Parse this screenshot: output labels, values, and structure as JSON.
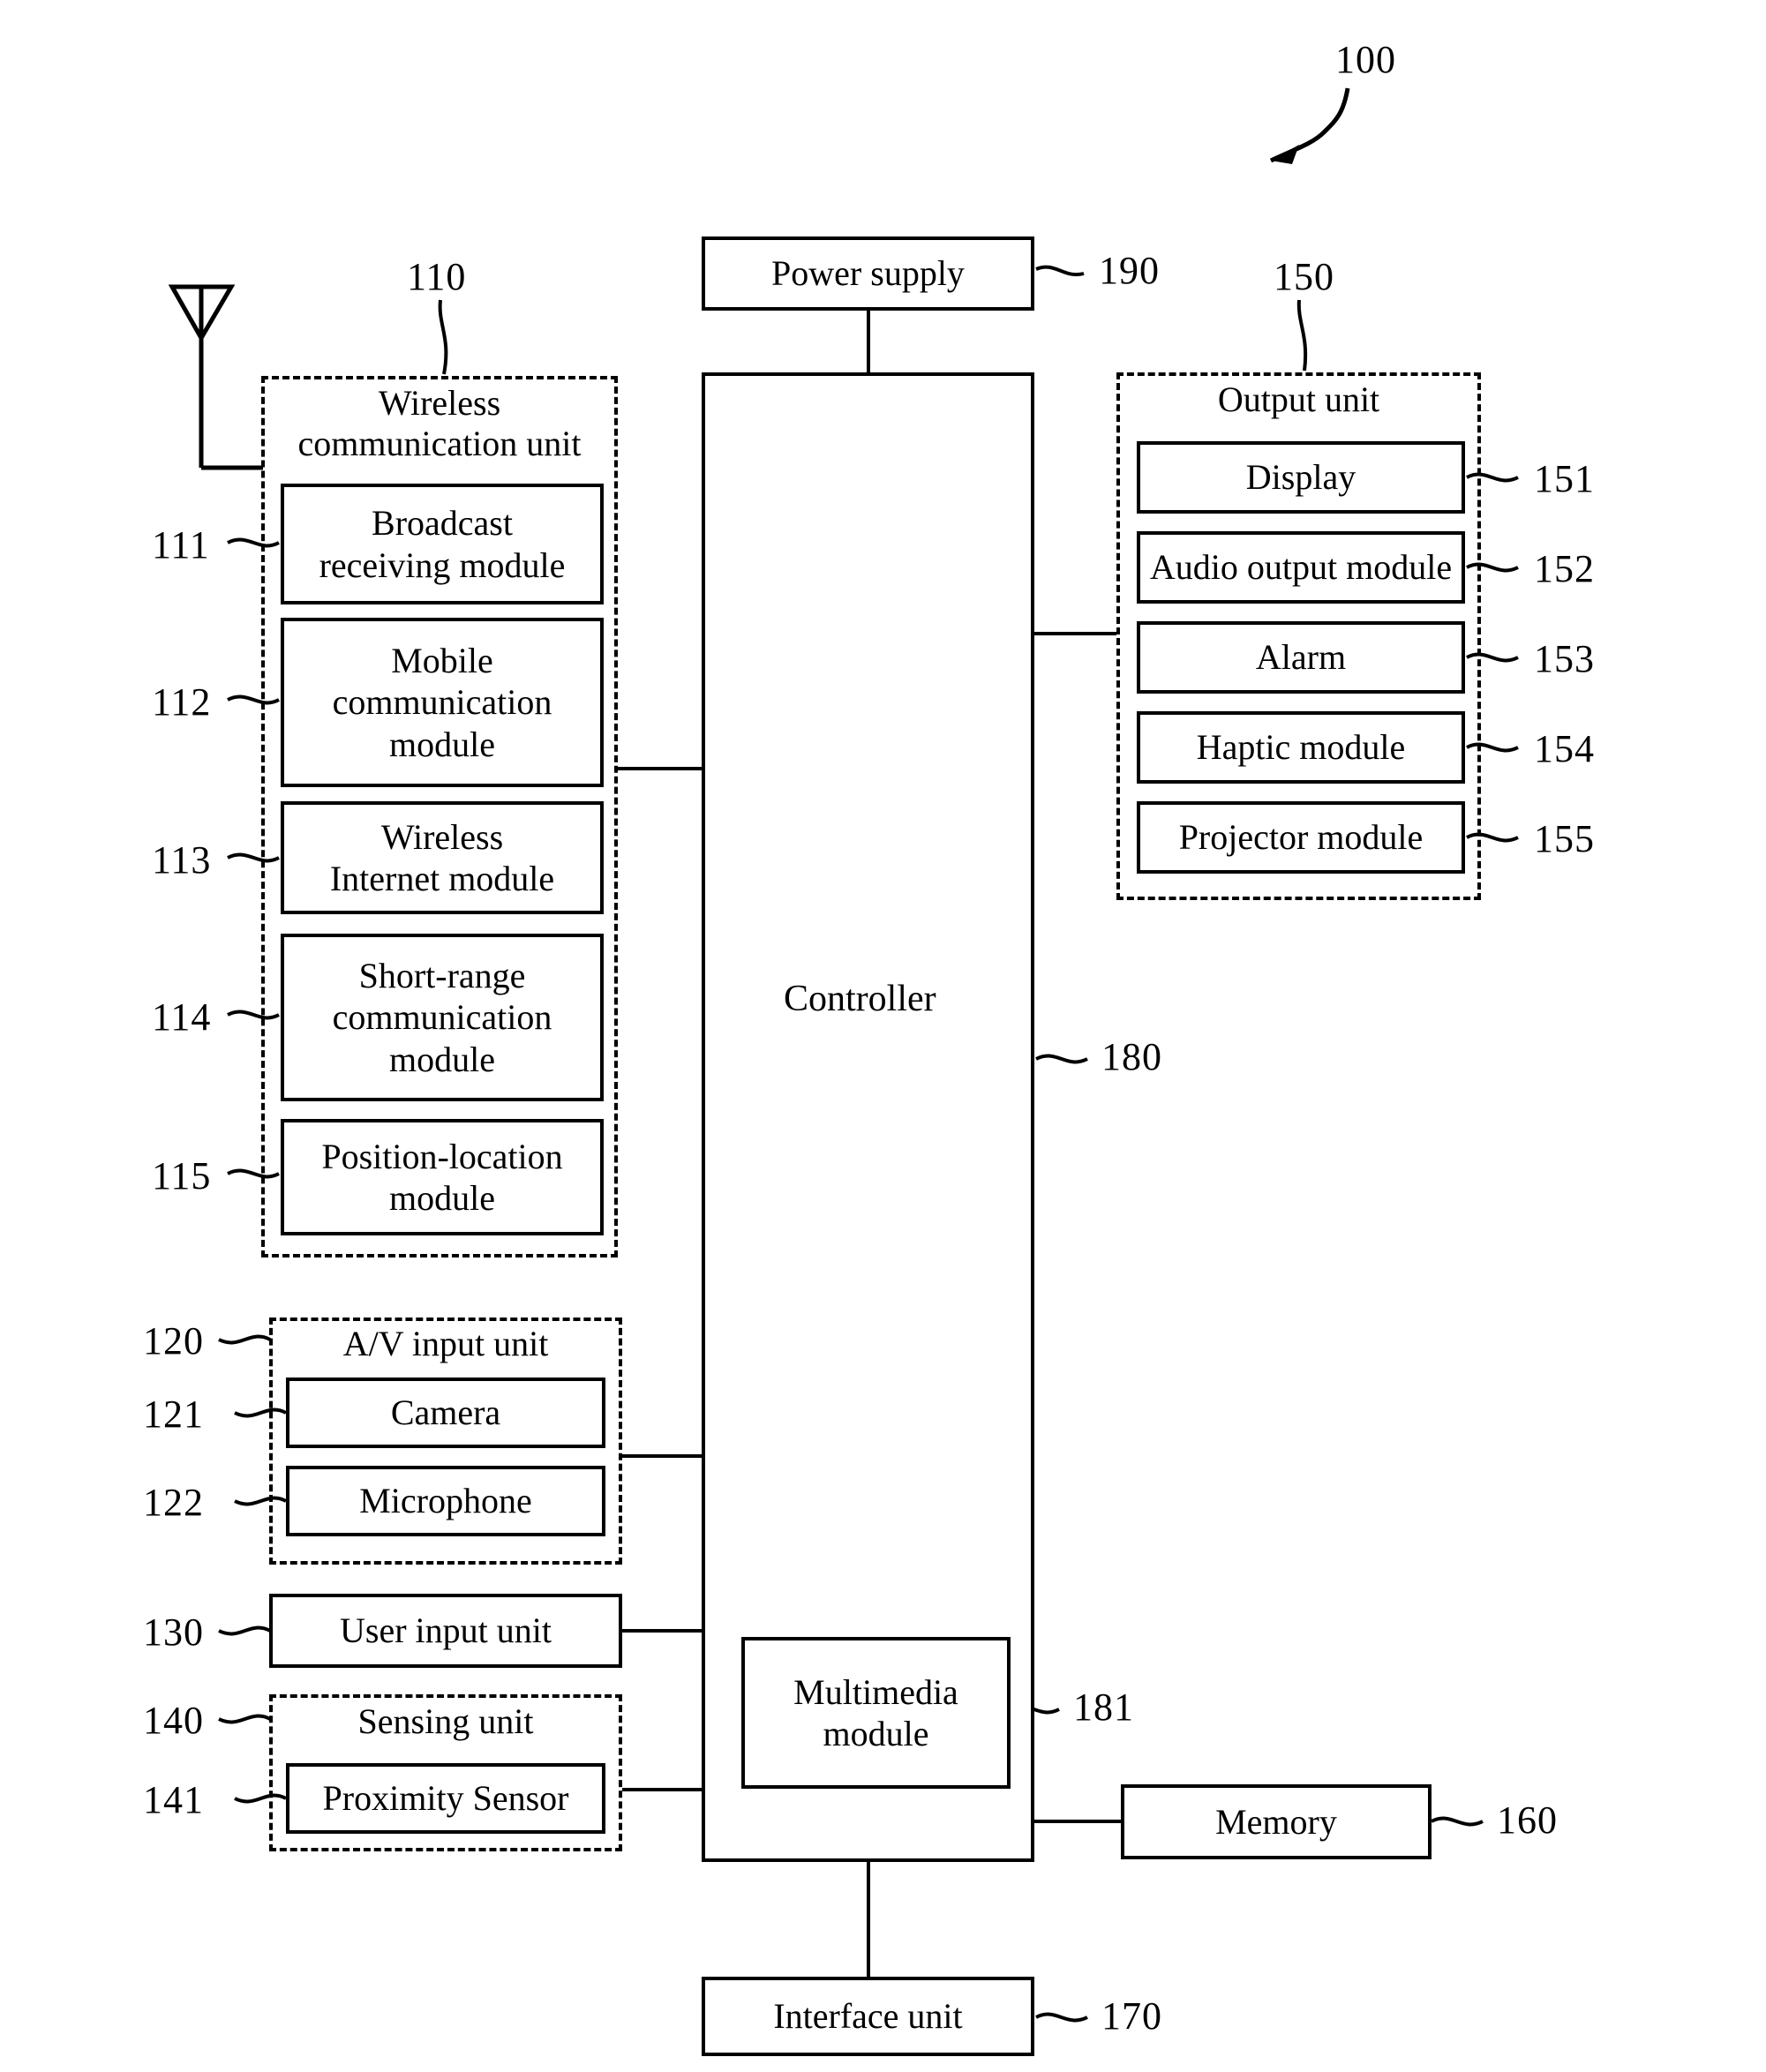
{
  "figure": {
    "system_ref": "100"
  },
  "power_supply": {
    "label": "Power supply",
    "ref": "190"
  },
  "controller": {
    "label": "Controller",
    "ref": "180"
  },
  "multimedia": {
    "label": "Multimedia\nmodule",
    "line1": "Multimedia",
    "line2": "module",
    "ref": "181"
  },
  "memory": {
    "label": "Memory",
    "ref": "160"
  },
  "interface": {
    "label": "Interface unit",
    "ref": "170"
  },
  "wireless_unit": {
    "title_line1": "Wireless",
    "title_line2": "communication unit",
    "ref": "110",
    "modules": [
      {
        "line1": "Broadcast",
        "line2": "receiving module",
        "line3": "",
        "ref": "111"
      },
      {
        "line1": "Mobile",
        "line2": "communication",
        "line3": "module",
        "ref": "112"
      },
      {
        "line1": "Wireless",
        "line2": "Internet module",
        "line3": "",
        "ref": "113"
      },
      {
        "line1": "Short-range",
        "line2": "communication",
        "line3": "module",
        "ref": "114"
      },
      {
        "line1": "Position-location",
        "line2": "module",
        "line3": "",
        "ref": "115"
      }
    ]
  },
  "av_input_unit": {
    "title": "A/V input unit",
    "ref": "120",
    "modules": [
      {
        "label": "Camera",
        "ref": "121"
      },
      {
        "label": "Microphone",
        "ref": "122"
      }
    ]
  },
  "user_input_unit": {
    "label": "User input unit",
    "ref": "130"
  },
  "sensing_unit": {
    "title": "Sensing unit",
    "ref": "140",
    "modules": [
      {
        "label": "Proximity Sensor",
        "ref": "141"
      }
    ]
  },
  "output_unit": {
    "title": "Output unit",
    "ref": "150",
    "modules": [
      {
        "label": "Display",
        "ref": "151"
      },
      {
        "label": "Audio output module",
        "ref": "152"
      },
      {
        "label": "Alarm",
        "ref": "153"
      },
      {
        "label": "Haptic module",
        "ref": "154"
      },
      {
        "label": "Projector module",
        "ref": "155"
      }
    ]
  },
  "antenna": {
    "name": "antenna-symbol"
  }
}
